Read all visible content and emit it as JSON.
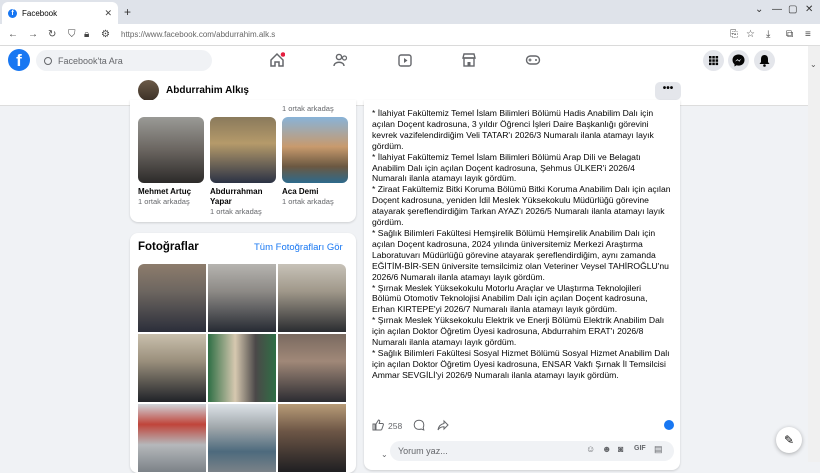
{
  "browser": {
    "tab_title": "Facebook",
    "url": "https://www.facebook.com/abdurrahim.alk.s"
  },
  "header": {
    "search_placeholder": "Facebook'ta Ara"
  },
  "profile": {
    "name": "Abdurrahim Alkış",
    "more": "•••"
  },
  "friends": {
    "top_mutual": "1 ortak arkadaş",
    "items": [
      {
        "name": "Mehmet Artuç",
        "mutual": "1 ortak arkadaş"
      },
      {
        "name": "Abdurrahman Yapar",
        "mutual": "1 ortak arkadaş"
      },
      {
        "name": "Aca Demi",
        "mutual": "1 ortak arkadaş"
      }
    ]
  },
  "photos": {
    "title": "Fotoğraflar",
    "see_all": "Tüm Fotoğrafları Gör"
  },
  "post": {
    "text": "* İlahiyat Fakültemiz Temel İslam Bilimleri Bölümü Hadis Anabilim Dalı için açılan Doçent kadrosuna, 3 yıldır Öğrenci İşleri Daire Başkanlığı görevini kevrek vazifelendirdiğim Veli TATAR'ı 2026/3  Numaralı ilanla atamayı layık gördüm.\n* İlahiyat Fakültemiz Temel İslam Bilimleri Bölümü Arap Dili ve Belagatı Anabilim Dalı için açılan Doçent kadrosuna, Şehmus ÜLKER'i 2026/4 Numaralı ilanla atamayı layık gördüm.\n* Ziraat Fakültemiz Bitki Koruma Bölümü Bitki Koruma Anabilim Dalı için açılan Doçent kadrosuna, yeniden İdil Meslek Yüksekokulu Müdürlüğü görevine atayarak şereflendirdiğim Tarkan AYAZ'ı 2026/5  Numaralı ilanla atamayı layık gördüm.\n* Sağlık Bilimleri Fakültesi Hemşirelik Bölümü Hemşirelik Anabilim Dalı için açılan Doçent kadrosuna, 2024 yılında üniversitemiz Merkezi Araştırma Laboratuvarı Müdürlüğü görevine atayarak şereflendirdiğim, aynı zamanda EĞİTİM-BİR-SEN üniversite temsilcimiz olan Veteriner Veysel TAHİROĞLU'nu 2026/6  Numaralı ilanla atamayı layık gördüm.\n* Şırnak Meslek Yüksekokulu Motorlu Araçlar ve Ulaştırma Teknolojileri Bölümü Otomotiv Teknolojisi Anabilim Dalı için açılan Doçent kadrosuna, Erhan KIRTEPE'yi 2026/7  Numaralı ilanla atamayı layık gördüm.\n* Şırnak Meslek Yüksekokulu Elektrik ve Enerji Bölümü Elektrik Anabilim Dalı için açılan Doktor Öğretim Üyesi kadrosuna, Abdurrahim ERAT'ı 2026/8 Numaralı ilanla atamayı layık gördüm.\n* Sağlık Bilimleri Fakültesi Sosyal Hizmet Bölümü Sosyal Hizmet Anabilim Dalı için açılan Doktor Öğretim Üyesi kadrosuna, ENSAR Vakfı Şırnak İl Temsilcisi Ammar SEVGİLİ'yi 2026/9  Numaralı ilanla atamayı layık gördüm.",
    "like_count": "258",
    "comment_placeholder": "Yorum yaz..."
  },
  "colors": {
    "brand": "#1877f2",
    "bg": "#f0f2f5"
  }
}
